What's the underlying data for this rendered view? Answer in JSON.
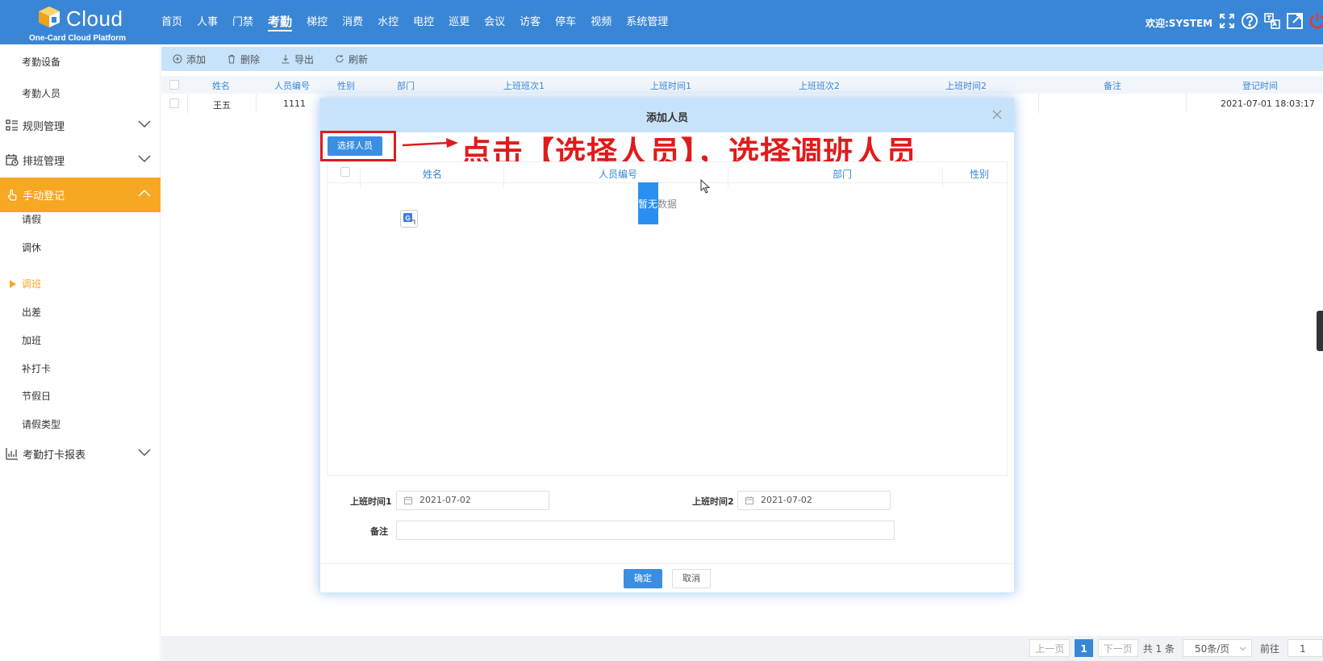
{
  "app": {
    "logo_word": "Cloud",
    "logo_sub": "One-Card Cloud Platform"
  },
  "topnav": {
    "items": [
      "首页",
      "人事",
      "门禁",
      "考勤",
      "梯控",
      "消费",
      "水控",
      "电控",
      "巡更",
      "会议",
      "访客",
      "停车",
      "视频",
      "系统管理"
    ],
    "active_index": 3,
    "welcome": "欢迎:SYSTEM",
    "icons": [
      "fullscreen-icon",
      "help-icon",
      "language-icon",
      "external-link-icon",
      "power-icon"
    ]
  },
  "sidebar": {
    "top_subitems": [
      "考勤设备",
      "考勤人员"
    ],
    "groups": {
      "rules": "规则管理",
      "schedule": "排班管理",
      "manual": "手动登记",
      "report": "考勤打卡报表"
    },
    "manual_items": [
      "请假",
      "调休",
      "调班",
      "出差",
      "加班",
      "补打卡",
      "节假日",
      "请假类型"
    ],
    "active_leaf": "调班"
  },
  "toolbar": {
    "add": "添加",
    "delete": "删除",
    "export": "导出",
    "refresh": "刷新"
  },
  "grid": {
    "columns": [
      "姓名",
      "人员编号",
      "性别",
      "部门",
      "上班班次1",
      "上班时间1",
      "上班班次2",
      "上班时间2",
      "备注",
      "登记时间"
    ],
    "rows": [
      {
        "name": "王五",
        "id": "1111",
        "reg_time": "2021-07-01 18:03:17"
      }
    ]
  },
  "pager": {
    "prev": "上一页",
    "current": "1",
    "next": "下一页",
    "total": "共 1 条",
    "page_size": "50条/页",
    "goto": "前往",
    "goto_value": "1"
  },
  "dialog": {
    "title": "添加人员",
    "select_button": "选择人员",
    "callout": "点击【选择人员】，选择调班人员",
    "table_columns": [
      "姓名",
      "人员编号",
      "部门",
      "性别"
    ],
    "empty_hl": "暂无",
    "empty_rest": "数据",
    "work_time1_label": "上班时间1",
    "work_time1_value": "2021-07-02",
    "work_time2_label": "上班时间2",
    "work_time2_value": "2021-07-02",
    "remark_label": "备注",
    "ok": "确定",
    "cancel": "取消"
  },
  "colors": {
    "primary": "#3a86d6",
    "active_orange": "#f7a823",
    "annotation_red": "#e01b1b",
    "toolbar_bg": "#c6e3fa"
  }
}
